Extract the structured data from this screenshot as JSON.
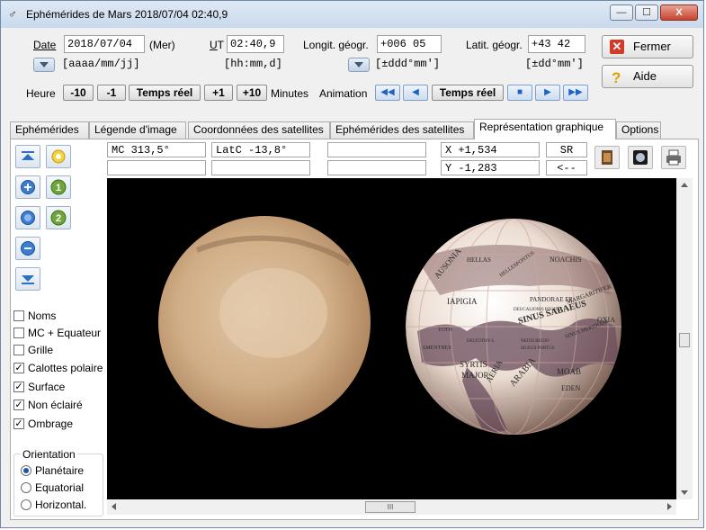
{
  "window": {
    "title": "Ephémérides de Mars  2018/07/04  02:40,9",
    "icon": "mars-symbol-icon",
    "controls": {
      "minimize": "—",
      "maximize": "☐",
      "close": "X"
    }
  },
  "date": {
    "label": "Date",
    "value": "2018/07/04",
    "weekday": "(Mer)",
    "format": "[aaaa/mm/jj]"
  },
  "ut": {
    "label": "UT",
    "value": "02:40,9",
    "format": "[hh:mm,d]"
  },
  "longitude": {
    "label": "Longit. géogr.",
    "value": "+006 05",
    "format": "[±ddd°mm']"
  },
  "latitude": {
    "label": "Latit. géogr.",
    "value": "+43 42",
    "format": "[±dd°mm']"
  },
  "buttons": {
    "fermer": "Fermer",
    "aide": "Aide"
  },
  "hour_controls": {
    "label": "Heure",
    "minus10": "-10",
    "minus1": "-1",
    "realtime": "Temps réel",
    "plus1": "+1",
    "plus10": "+10",
    "unit": "Minutes"
  },
  "animation": {
    "label": "Animation",
    "realtime": "Temps réel",
    "fast_back": "◀◀",
    "back": "◀",
    "stop": "■",
    "forward": "▶",
    "fast_forward": "▶▶"
  },
  "tabs": [
    {
      "label": "Ephémérides"
    },
    {
      "label": "Légende d'image"
    },
    {
      "label": "Coordonnées des satellites"
    },
    {
      "label": "Ephémérides des satellites"
    },
    {
      "label": "Représentation graphique"
    },
    {
      "label": "Options"
    }
  ],
  "active_tab": "Représentation graphique",
  "info": {
    "mc": "MC  313,5°",
    "latc": "LatC -13,8°",
    "empty1": "",
    "empty2": "",
    "empty3": "",
    "empty4": "",
    "x": "X  +1,534",
    "y": "Y  -1,283",
    "sr": "SR",
    "back": "<--"
  },
  "toolbar_badges": {
    "one": "1",
    "two": "2"
  },
  "checkboxes": [
    {
      "label": "Noms",
      "checked": false
    },
    {
      "label": "MC + Equateur",
      "checked": false
    },
    {
      "label": "Grille",
      "checked": false
    },
    {
      "label": "Calottes polaire",
      "checked": true
    },
    {
      "label": "Surface",
      "checked": true
    },
    {
      "label": "Non éclairé",
      "checked": true
    },
    {
      "label": "Ombrage",
      "checked": true
    }
  ],
  "orientation": {
    "title": "Orientation",
    "options": [
      {
        "label": "Planétaire",
        "selected": true
      },
      {
        "label": "Equatorial",
        "selected": false
      },
      {
        "label": "Horizontal.",
        "selected": false
      }
    ]
  },
  "map_labels": [
    "HELLAS",
    "HELLESPONTUS",
    "NOACHIS",
    "AUSONIA",
    "IAPIGIA",
    "PANDORAE FR.",
    "DEUCALIONIS REGIO",
    "MARGARITIFER",
    "SINUS SABAEUS",
    "SINUS MERIDIANI",
    "OXIA",
    "SYRTIS",
    "MAJOR",
    "AERIA",
    "ARABIA",
    "MOAB",
    "EDEN",
    "DELTOTON S.",
    "NEITH REGIO",
    "SIGEUS PORTUS",
    "TOTH",
    "AMENTHES"
  ],
  "scrollbar": {
    "grip": "III"
  }
}
